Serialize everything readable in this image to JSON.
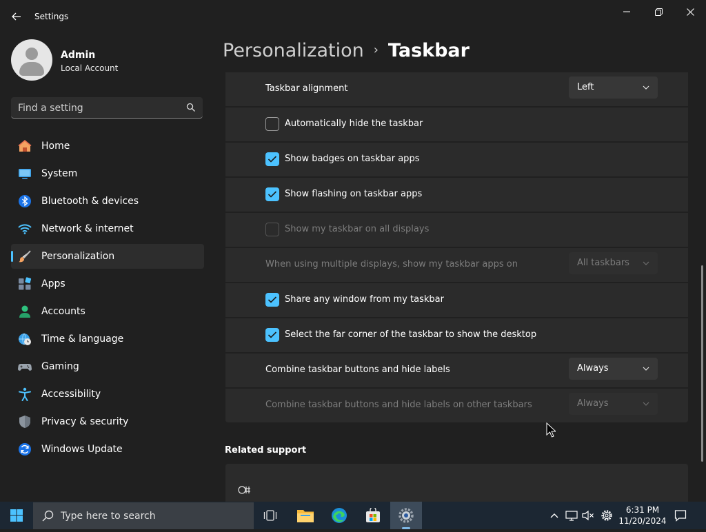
{
  "window": {
    "title": "Settings",
    "back_icon": "arrow-left-icon",
    "controls": [
      "minimize-icon",
      "maximize-icon",
      "close-icon"
    ]
  },
  "profile": {
    "name": "Admin",
    "account_type": "Local Account"
  },
  "search": {
    "placeholder": "Find a setting"
  },
  "sidebar": {
    "items": [
      {
        "label": "Home",
        "icon": "home-icon"
      },
      {
        "label": "System",
        "icon": "system-icon"
      },
      {
        "label": "Bluetooth & devices",
        "icon": "bluetooth-icon"
      },
      {
        "label": "Network & internet",
        "icon": "wifi-icon"
      },
      {
        "label": "Personalization",
        "icon": "brush-icon",
        "active": true
      },
      {
        "label": "Apps",
        "icon": "apps-icon"
      },
      {
        "label": "Accounts",
        "icon": "accounts-icon"
      },
      {
        "label": "Time & language",
        "icon": "globe-clock-icon"
      },
      {
        "label": "Gaming",
        "icon": "gamepad-icon"
      },
      {
        "label": "Accessibility",
        "icon": "accessibility-icon"
      },
      {
        "label": "Privacy & security",
        "icon": "shield-icon"
      },
      {
        "label": "Windows Update",
        "icon": "update-icon"
      }
    ],
    "accent_color": "#4cc2ff"
  },
  "breadcrumb": {
    "parent": "Personalization",
    "separator": "›",
    "current": "Taskbar"
  },
  "settings": {
    "alignment": {
      "label": "Taskbar alignment",
      "value": "Left"
    },
    "auto_hide": {
      "label": "Automatically hide the taskbar",
      "checked": false
    },
    "badges": {
      "label": "Show badges on taskbar apps",
      "checked": true
    },
    "flashing": {
      "label": "Show flashing on taskbar apps",
      "checked": true
    },
    "all_displays": {
      "label": "Show my taskbar on all displays",
      "checked": false,
      "disabled": true
    },
    "multi_display": {
      "label": "When using multiple displays, show my taskbar apps on",
      "value": "All taskbars",
      "disabled": true
    },
    "share_window": {
      "label": "Share any window from my taskbar",
      "checked": true
    },
    "far_corner": {
      "label": "Select the far corner of the taskbar to show the desktop",
      "checked": true
    },
    "combine": {
      "label": "Combine taskbar buttons and hide labels",
      "value": "Always"
    },
    "combine_other": {
      "label": "Combine taskbar buttons and hide labels on other taskbars",
      "value": "Always",
      "disabled": true
    }
  },
  "related": {
    "title": "Related support"
  },
  "taskbar": {
    "search_placeholder": "Type here to search",
    "apps": [
      "task-view-icon",
      "file-explorer-icon",
      "edge-icon",
      "store-icon",
      "settings-icon"
    ],
    "tray_icons": [
      "chevron-up-icon",
      "network-icon",
      "volume-muted-icon",
      "gear-icon"
    ],
    "time": "6:31 PM",
    "date": "11/20/2024",
    "notification_icon": "notification-icon"
  }
}
